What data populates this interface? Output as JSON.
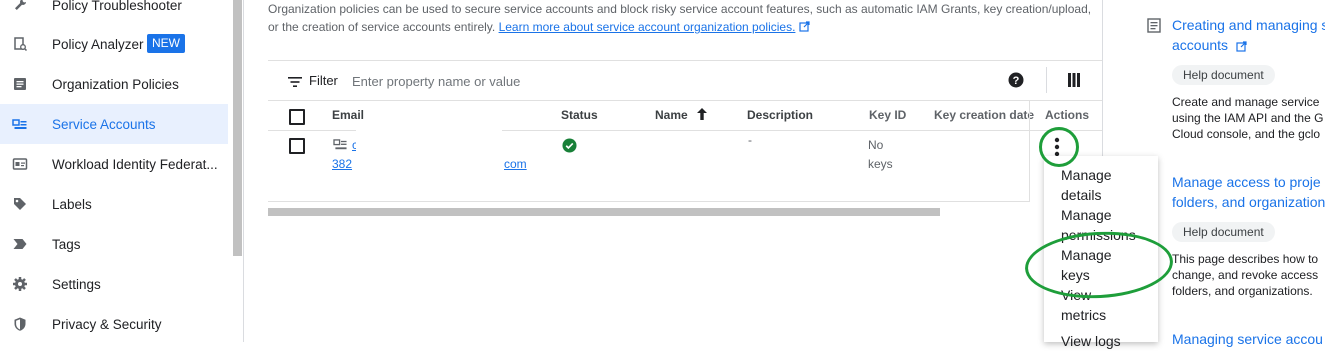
{
  "sidebar": {
    "items": [
      {
        "label": "Policy Troubleshooter",
        "icon": "wrench-icon"
      },
      {
        "label": "Policy Analyzer",
        "badge": "NEW",
        "icon": "document-search-icon"
      },
      {
        "label": "Organization Policies",
        "icon": "list-document-icon"
      },
      {
        "label": "Service Accounts",
        "icon": "service-account-icon",
        "active": true
      },
      {
        "label": "Workload Identity Federat...",
        "icon": "id-card-icon"
      },
      {
        "label": "Labels",
        "icon": "tag-icon"
      },
      {
        "label": "Tags",
        "icon": "chevron-tag-icon"
      },
      {
        "label": "Settings",
        "icon": "gear-icon"
      },
      {
        "label": "Privacy & Security",
        "icon": "shield-icon"
      }
    ]
  },
  "intro": {
    "line1": "Organization policies can be used to secure service accounts and block risky service account features, such as automatic IAM Grants, key creation/upload,",
    "line2": "or the creation of service accounts entirely.",
    "link": "Learn more about service account organization policies."
  },
  "filter": {
    "label": "Filter",
    "placeholder": "Enter property name or value"
  },
  "table": {
    "columns": {
      "email": "Email",
      "status": "Status",
      "name": "Name",
      "description": "Description",
      "key_id": "Key ID",
      "key_creation_date": "Key creation date",
      "actions": "Actions"
    },
    "row": {
      "email_line1": "c",
      "email_prefix": "382",
      "email_suffix": "com",
      "description": "-",
      "key_id_line1": "No",
      "key_id_line2": "keys"
    }
  },
  "action_menu": {
    "items": [
      {
        "line1": "Manage",
        "line2": "details"
      },
      {
        "line1": "Manage",
        "line2": "permissions"
      },
      {
        "line1": "Manage",
        "line2": "keys"
      },
      {
        "line1": "View",
        "line2": "metrics"
      },
      {
        "line1": "View logs",
        "line2": ""
      }
    ]
  },
  "right_panel": {
    "docs": [
      {
        "title_line1": "Creating and managing s",
        "title_line2": "accounts",
        "chip": "Help document",
        "desc": [
          "Create and manage service",
          "using the IAM API and the G",
          "Cloud console, and the gclo"
        ]
      },
      {
        "title_line1": "Manage access to proje",
        "title_line2": "folders, and organization",
        "chip": "Help document",
        "desc": [
          "This page describes how to",
          "change, and revoke access",
          "folders, and organizations."
        ]
      },
      {
        "title_line1": "Managing service accou",
        "title_line2": ""
      }
    ]
  },
  "colors": {
    "accent": "#1a73e8",
    "annotation": "#1e9e3a",
    "status_ok": "#188038"
  }
}
